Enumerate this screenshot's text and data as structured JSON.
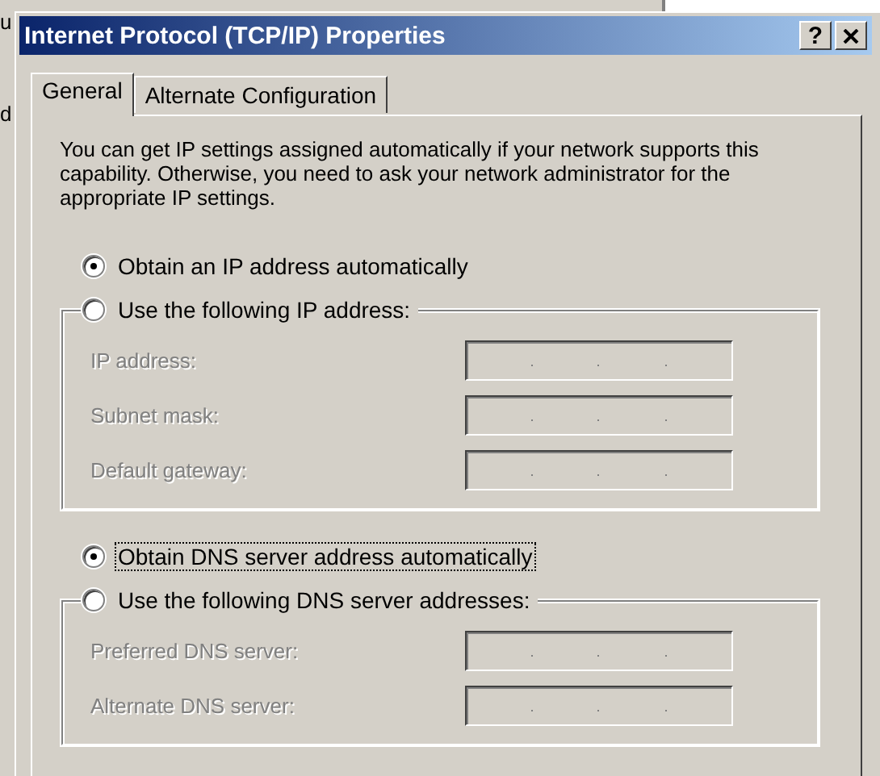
{
  "background_window": {
    "texts": [
      "u",
      "d"
    ]
  },
  "window": {
    "title": "Internet Protocol (TCP/IP) Properties",
    "buttons": [
      {
        "kind": "help",
        "label": "?"
      },
      {
        "kind": "close"
      }
    ]
  },
  "tabs": [
    {
      "label": "General",
      "selected": true
    },
    {
      "label": "Alternate Configuration",
      "selected": false
    }
  ],
  "description": "You can get IP settings assigned automatically if your network supports this capability. Otherwise, you need to ask your network administrator for the appropriate IP settings.",
  "options": [
    {
      "kind": "radio",
      "label": "Obtain an IP address automatically",
      "selected": true,
      "focused": false
    },
    {
      "kind": "group",
      "label": "Use the following IP address:",
      "selected": false,
      "focused": false,
      "fields": [
        {
          "label": "IP address:",
          "disabled": true
        },
        {
          "label": "Subnet mask:",
          "disabled": true
        },
        {
          "label": "Default gateway:",
          "disabled": true
        }
      ]
    },
    {
      "kind": "radio",
      "label": "Obtain DNS server address automatically",
      "selected": true,
      "focused": true
    },
    {
      "kind": "group",
      "label": "Use the following DNS server addresses:",
      "selected": false,
      "focused": false,
      "fields": [
        {
          "label": "Preferred DNS server:",
          "disabled": true
        },
        {
          "label": "Alternate DNS server:",
          "disabled": true
        }
      ]
    }
  ]
}
